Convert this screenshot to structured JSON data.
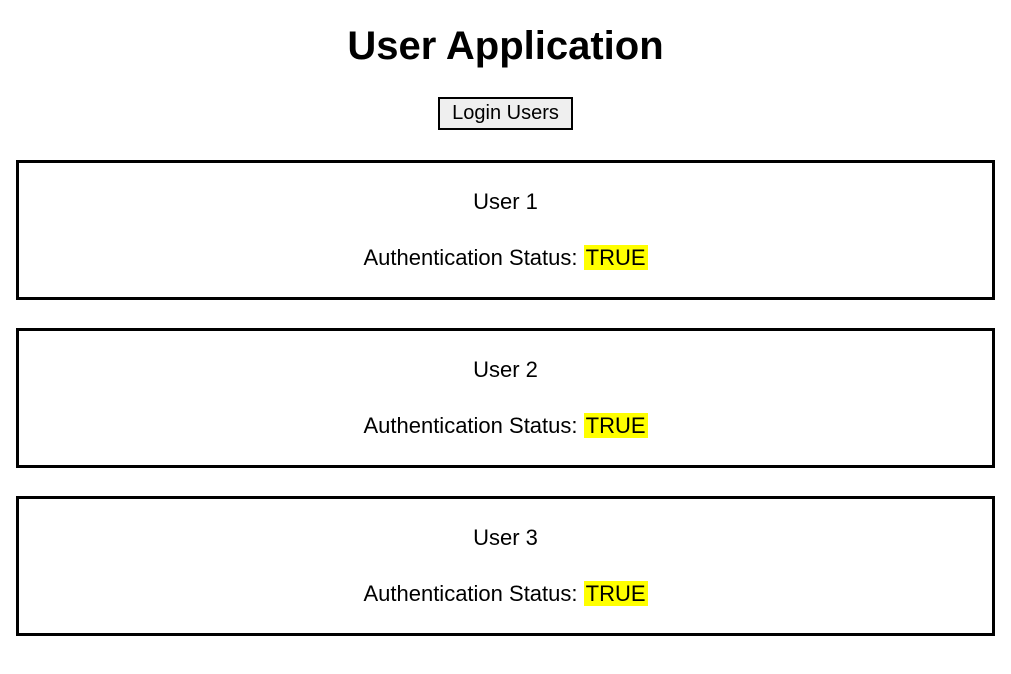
{
  "header": {
    "title": "User Application",
    "login_button_label": "Login Users"
  },
  "auth_label": "Authentication Status:",
  "users": [
    {
      "name": "User 1",
      "auth_status": "TRUE"
    },
    {
      "name": "User 2",
      "auth_status": "TRUE"
    },
    {
      "name": "User 3",
      "auth_status": "TRUE"
    }
  ]
}
